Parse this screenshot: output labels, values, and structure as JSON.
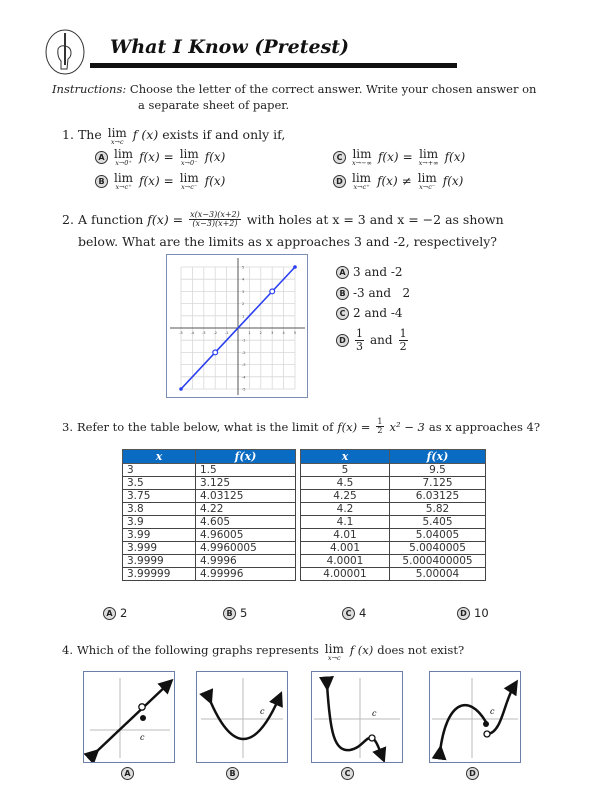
{
  "header": {
    "icon": "hand-holding-pencil-icon",
    "title": "What I Know (Pretest)"
  },
  "instructions": {
    "lead": "Instructions:",
    "text_line1": " Choose the letter of the correct answer. Write your chosen answer on",
    "text_line2": "a separate sheet of paper."
  },
  "q1": {
    "number": "1.",
    "prefix": "The",
    "lim_word": "lim",
    "lim_sub": "x→c",
    "func": "f (x)",
    "suffix": "exists if and only if,",
    "options": [
      {
        "letter": "A",
        "left_sub": "x→0⁺",
        "relation": "=",
        "right_sub": "x→0⁻"
      },
      {
        "letter": "B",
        "left_sub": "x→c⁺",
        "relation": "=",
        "right_sub": "x→c⁻"
      },
      {
        "letter": "C",
        "left_sub": "x→−∞",
        "relation": "=",
        "right_sub": "x→+∞"
      },
      {
        "letter": "D",
        "left_sub": "x→c⁺",
        "relation": "≠",
        "right_sub": "x→c⁻"
      }
    ],
    "fx": "f(x)"
  },
  "q2": {
    "number": "2.",
    "prefix": "A function",
    "fx_eq": "f(x) =",
    "numerator": "x(x−3)(x+2)",
    "denominator": "(x−3)(x+2)",
    "suffix_line1": "with holes at x = 3 and x = −2 as shown",
    "line2": "below. What are the limits as x approaches 3 and -2, respectively?",
    "options": [
      {
        "letter": "A",
        "text": "3 and -2"
      },
      {
        "letter": "B",
        "text": "-3 and   2"
      },
      {
        "letter": "C",
        "text": "2 and -4"
      },
      {
        "letter": "D",
        "frac1_n": "1",
        "frac1_d": "3",
        "mid": "and",
        "frac2_n": "1",
        "frac2_d": "2"
      }
    ]
  },
  "chart_data": {
    "type": "line",
    "title": "",
    "xlabel": "",
    "ylabel": "",
    "xlim": [
      -5,
      5
    ],
    "ylim": [
      -5,
      5
    ],
    "x_ticks": [
      -5,
      -4,
      -3,
      -2,
      -1,
      1,
      2,
      3,
      4,
      5
    ],
    "y_ticks": [
      -5,
      -4,
      -3,
      -2,
      -1,
      1,
      2,
      3,
      4,
      5
    ],
    "grid": true,
    "series": [
      {
        "name": "f(x) = x",
        "x": [
          -5,
          5
        ],
        "y": [
          -5,
          5
        ],
        "color": "#2a3ff0"
      }
    ],
    "open_points": [
      {
        "x": -2,
        "y": -2
      },
      {
        "x": 3,
        "y": 3
      }
    ]
  },
  "q3": {
    "number": "3.",
    "text": "Refer to the table below, what is the limit of",
    "fx_eq": "f(x) =",
    "frac_n": "1",
    "frac_d": "2",
    "rest": "x² − 3",
    "suffix": "as x approaches 4?",
    "table_left": {
      "headers": [
        "x",
        "f(x)"
      ],
      "rows": [
        [
          "3",
          "1.5"
        ],
        [
          "3.5",
          "3.125"
        ],
        [
          "3.75",
          "4.03125"
        ],
        [
          "3.8",
          "4.22"
        ],
        [
          "3.9",
          "4.605"
        ],
        [
          "3.99",
          "4.96005"
        ],
        [
          "3.999",
          "4.9960005"
        ],
        [
          "3.9999",
          "4.9996"
        ],
        [
          "3.99999",
          "4.99996"
        ]
      ]
    },
    "table_right": {
      "headers": [
        "x",
        "f(x)"
      ],
      "rows": [
        [
          "5",
          "9.5"
        ],
        [
          "4.5",
          "7.125"
        ],
        [
          "4.25",
          "6.03125"
        ],
        [
          "4.2",
          "5.82"
        ],
        [
          "4.1",
          "5.405"
        ],
        [
          "4.01",
          "5.04005"
        ],
        [
          "4.001",
          "5.0040005"
        ],
        [
          "4.0001",
          "5.000400005"
        ],
        [
          "4.00001",
          "5.00004"
        ]
      ]
    },
    "options": [
      {
        "letter": "A",
        "text": "2"
      },
      {
        "letter": "B",
        "text": "5"
      },
      {
        "letter": "C",
        "text": "4"
      },
      {
        "letter": "D",
        "text": "10"
      }
    ]
  },
  "q4": {
    "number": "4.",
    "text": "Which of the following graphs represents",
    "lim_word": "lim",
    "lim_sub": "x→c",
    "func": "f (x)",
    "suffix": "does not exist?",
    "c_label": "c",
    "options": [
      {
        "letter": "A",
        "description": "line with hole at c and filled point below"
      },
      {
        "letter": "B",
        "description": "parabola, continuous at c"
      },
      {
        "letter": "C",
        "description": "curve with hole after c"
      },
      {
        "letter": "D",
        "description": "jump discontinuity at c"
      }
    ]
  }
}
